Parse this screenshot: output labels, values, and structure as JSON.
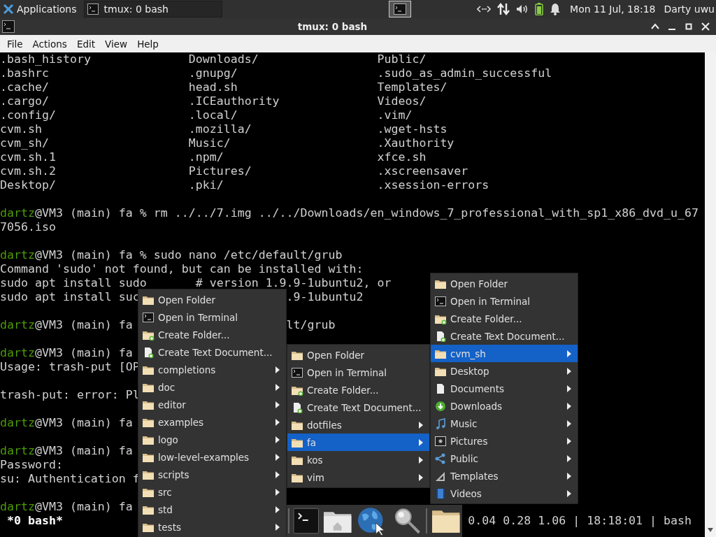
{
  "panel": {
    "apps_label": "Applications",
    "task": {
      "title": "tmux: 0 bash",
      "selected": false
    },
    "workspace_selected": true,
    "clock": "Mon 11 Jul, 18:18",
    "user": "Darty uwu"
  },
  "window": {
    "title": "tmux: 0 bash",
    "menu": [
      "File",
      "Actions",
      "Edit",
      "View",
      "Help"
    ]
  },
  "terminal": {
    "listing": [
      [
        ".bash_history",
        "Downloads/",
        "Public/"
      ],
      [
        ".bashrc",
        ".gnupg/",
        ".sudo_as_admin_successful"
      ],
      [
        ".cache/",
        "head.sh",
        "Templates/"
      ],
      [
        ".cargo/",
        ".ICEauthority",
        "Videos/"
      ],
      [
        ".config/",
        ".local/",
        ".vim/"
      ],
      [
        "cvm.sh",
        ".mozilla/",
        ".wget-hsts"
      ],
      [
        "cvm_sh/",
        "Music/",
        ".Xauthority"
      ],
      [
        "cvm.sh.1",
        ".npm/",
        "xfce.sh"
      ],
      [
        "cvm.sh.2",
        "Pictures/",
        ".xscreensaver"
      ],
      [
        "Desktop/",
        ".pki/",
        ".xsession-errors"
      ]
    ],
    "lines": [
      {
        "kind": "blank"
      },
      {
        "kind": "prompt",
        "user": "dartz",
        "text": "@VM3 (main) fa % rm ../../7.img ../../Downloads/en_windows_7_professional_with_sp1_x86_dvd_u_67"
      },
      {
        "kind": "output",
        "text": "7056.iso"
      },
      {
        "kind": "blank"
      },
      {
        "kind": "prompt",
        "user": "dartz",
        "text": "@VM3 (main) fa % sudo nano /etc/default/grub"
      },
      {
        "kind": "output",
        "text": "Command 'sudo' not found, but can be installed with:"
      },
      {
        "kind": "output",
        "text": "sudo apt install sudo       # version 1.9.9-1ubuntu2, or"
      },
      {
        "kind": "output",
        "text": "sudo apt install suc",
        "right": ".9-1ubuntu2"
      },
      {
        "kind": "blank"
      },
      {
        "kind": "prompt",
        "user": "dartz",
        "text": "@VM3 (main) fa",
        "right": "lt/grub"
      },
      {
        "kind": "blank"
      },
      {
        "kind": "prompt",
        "user": "dartz",
        "text": "@VM3 (main) fa"
      },
      {
        "kind": "output",
        "text": "Usage: trash-put [OP"
      },
      {
        "kind": "blank"
      },
      {
        "kind": "output",
        "text": "trash-put: error: Pl"
      },
      {
        "kind": "blank"
      },
      {
        "kind": "prompt",
        "user": "dartz",
        "text": "@VM3 (main) fa"
      },
      {
        "kind": "blank"
      },
      {
        "kind": "prompt",
        "user": "dartz",
        "text": "@VM3 (main) fa"
      },
      {
        "kind": "output",
        "text": "Password:"
      },
      {
        "kind": "output",
        "text": "su: Authentication f"
      },
      {
        "kind": "blank"
      },
      {
        "kind": "prompt",
        "user": "dartz",
        "text": "@VM3 (main) fa"
      }
    ],
    "status_left": " *0 bash*",
    "status_right": "0.04 0.28 1.06 | 18:18:01 | bash"
  },
  "menus": [
    {
      "items": [
        {
          "kind": "folder",
          "label": "Open Folder",
          "submenu": false,
          "selected": false
        },
        {
          "kind": "terminal",
          "label": "Open in Terminal",
          "submenu": false,
          "selected": false
        },
        {
          "kind": "new-folder",
          "label": "Create Folder...",
          "submenu": false,
          "selected": false
        },
        {
          "kind": "new-document",
          "label": "Create Text Document...",
          "submenu": false,
          "selected": false
        },
        {
          "kind": "folder",
          "label": "completions",
          "submenu": true,
          "selected": false
        },
        {
          "kind": "folder",
          "label": "doc",
          "submenu": true,
          "selected": false
        },
        {
          "kind": "folder",
          "label": "editor",
          "submenu": true,
          "selected": false
        },
        {
          "kind": "folder",
          "label": "examples",
          "submenu": true,
          "selected": false
        },
        {
          "kind": "folder",
          "label": "logo",
          "submenu": true,
          "selected": false
        },
        {
          "kind": "folder",
          "label": "low-level-examples",
          "submenu": true,
          "selected": false
        },
        {
          "kind": "folder",
          "label": "scripts",
          "submenu": true,
          "selected": false
        },
        {
          "kind": "folder",
          "label": "src",
          "submenu": true,
          "selected": false
        },
        {
          "kind": "folder",
          "label": "std",
          "submenu": true,
          "selected": false
        },
        {
          "kind": "folder",
          "label": "tests",
          "submenu": true,
          "selected": false
        }
      ]
    },
    {
      "items": [
        {
          "kind": "folder",
          "label": "Open Folder",
          "submenu": false,
          "selected": false
        },
        {
          "kind": "terminal",
          "label": "Open in Terminal",
          "submenu": false,
          "selected": false
        },
        {
          "kind": "new-folder",
          "label": "Create Folder...",
          "submenu": false,
          "selected": false
        },
        {
          "kind": "new-document",
          "label": "Create Text Document...",
          "submenu": false,
          "selected": false
        },
        {
          "kind": "folder",
          "label": "dotfiles",
          "submenu": true,
          "selected": false
        },
        {
          "kind": "folder",
          "label": "fa",
          "submenu": true,
          "selected": true
        },
        {
          "kind": "folder",
          "label": "kos",
          "submenu": true,
          "selected": false
        },
        {
          "kind": "folder",
          "label": "vim",
          "submenu": true,
          "selected": false
        }
      ]
    },
    {
      "items": [
        {
          "kind": "folder",
          "label": "Open Folder",
          "submenu": false,
          "selected": false
        },
        {
          "kind": "terminal",
          "label": "Open in Terminal",
          "submenu": false,
          "selected": false
        },
        {
          "kind": "new-folder",
          "label": "Create Folder...",
          "submenu": false,
          "selected": false
        },
        {
          "kind": "new-document",
          "label": "Create Text Document...",
          "submenu": false,
          "selected": false
        },
        {
          "kind": "folder",
          "label": "cvm_sh",
          "submenu": true,
          "selected": true
        },
        {
          "kind": "folder",
          "label": "Desktop",
          "submenu": true,
          "selected": false
        },
        {
          "kind": "document",
          "label": "Documents",
          "submenu": true,
          "selected": false
        },
        {
          "kind": "download",
          "label": "Downloads",
          "submenu": true,
          "selected": false
        },
        {
          "kind": "music",
          "label": "Music",
          "submenu": true,
          "selected": false
        },
        {
          "kind": "pictures",
          "label": "Pictures",
          "submenu": true,
          "selected": false
        },
        {
          "kind": "public",
          "label": "Public",
          "submenu": true,
          "selected": false
        },
        {
          "kind": "templates",
          "label": "Templates",
          "submenu": true,
          "selected": false
        },
        {
          "kind": "videos",
          "label": "Videos",
          "submenu": true,
          "selected": false
        }
      ]
    }
  ],
  "dock": {
    "items": [
      {
        "kind": "separator"
      },
      {
        "kind": "terminal"
      },
      {
        "kind": "home"
      },
      {
        "kind": "browser"
      },
      {
        "kind": "search"
      },
      {
        "kind": "separator"
      },
      {
        "kind": "files"
      }
    ]
  }
}
